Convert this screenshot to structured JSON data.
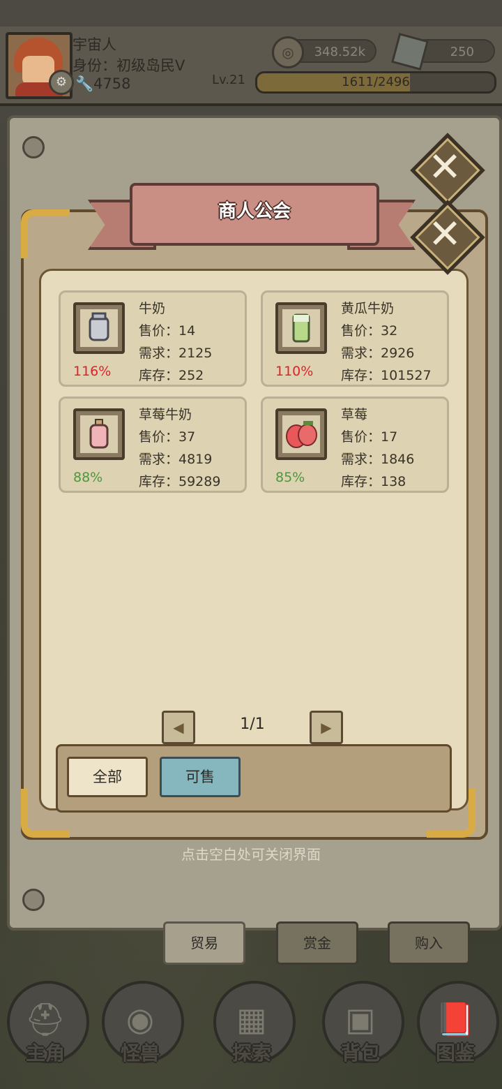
{
  "header": {
    "username": "宇宙人",
    "identity": "身份：初级岛民Ⅴ",
    "power": "4758",
    "coins": "348.52k",
    "gems": "250",
    "level": "Lv.21",
    "xp_text": "1611/2496",
    "xp_progress": 0.645
  },
  "modal": {
    "title": "商人公会",
    "items": [
      {
        "name": "牛奶",
        "price": "售价：14",
        "demand": "需求：2125",
        "stock": "库存：252",
        "percent": "116%",
        "percent_color": "#e0212a",
        "icon": "milk-can-icon"
      },
      {
        "name": "黄瓜牛奶",
        "price": "售价：32",
        "demand": "需求：2926",
        "stock": "库存：101527",
        "percent": "110%",
        "percent_color": "#e0212a",
        "icon": "cucumber-milk-glass-icon"
      },
      {
        "name": "草莓牛奶",
        "price": "售价：37",
        "demand": "需求：4819",
        "stock": "库存：59289",
        "percent": "88%",
        "percent_color": "#4a9a3b",
        "icon": "strawberry-milk-bottle-icon"
      },
      {
        "name": "草莓",
        "price": "售价：17",
        "demand": "需求：1846",
        "stock": "库存：138",
        "percent": "85%",
        "percent_color": "#4a9a3b",
        "icon": "strawberry-icon"
      }
    ],
    "pagination": "1/1",
    "filter_all": "全部",
    "filter_sellable": "可售",
    "close_hint": "点击空白处可关闭界面"
  },
  "tabs": [
    "贸易",
    "赏金",
    "购入"
  ],
  "nav": [
    "主角",
    "怪兽",
    "探索",
    "背包",
    "图鉴"
  ]
}
